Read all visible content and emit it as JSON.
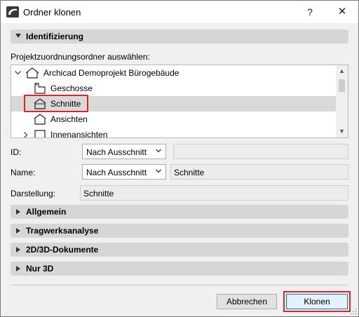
{
  "window": {
    "title": "Ordner klonen",
    "help_glyph": "?",
    "close_glyph": "✕"
  },
  "identification": {
    "header": "Identifizierung",
    "folder_prompt": "Projektzuordnungsordner auswählen:",
    "tree": [
      {
        "label": "Archicad Demoprojekt Bürogebäude",
        "icon": "project-house-icon",
        "expanded": true
      },
      {
        "label": "Geschosse",
        "icon": "stories-icon",
        "selected": false
      },
      {
        "label": "Schnitte",
        "icon": "section-icon",
        "selected": true
      },
      {
        "label": "Ansichten",
        "icon": "elevation-icon",
        "selected": false
      },
      {
        "label": "Innenansichten",
        "icon": "interior-elevation-icon",
        "selected": false
      }
    ],
    "id_label": "ID:",
    "id_select": "Nach Ausschnitt",
    "id_value": "",
    "name_label": "Name:",
    "name_select": "Nach Ausschnitt",
    "name_value": "Schnitte",
    "display_label": "Darstellung:",
    "display_value": "Schnitte"
  },
  "sections": [
    {
      "label": "Allgemein"
    },
    {
      "label": "Tragwerksanalyse"
    },
    {
      "label": "2D/3D-Dokumente"
    },
    {
      "label": "Nur 3D"
    }
  ],
  "buttons": {
    "cancel": "Abbrechen",
    "clone": "Klonen"
  },
  "colors": {
    "highlight": "#e0232a",
    "selection": "#d9d9d9",
    "primary_border": "#0078d7"
  }
}
